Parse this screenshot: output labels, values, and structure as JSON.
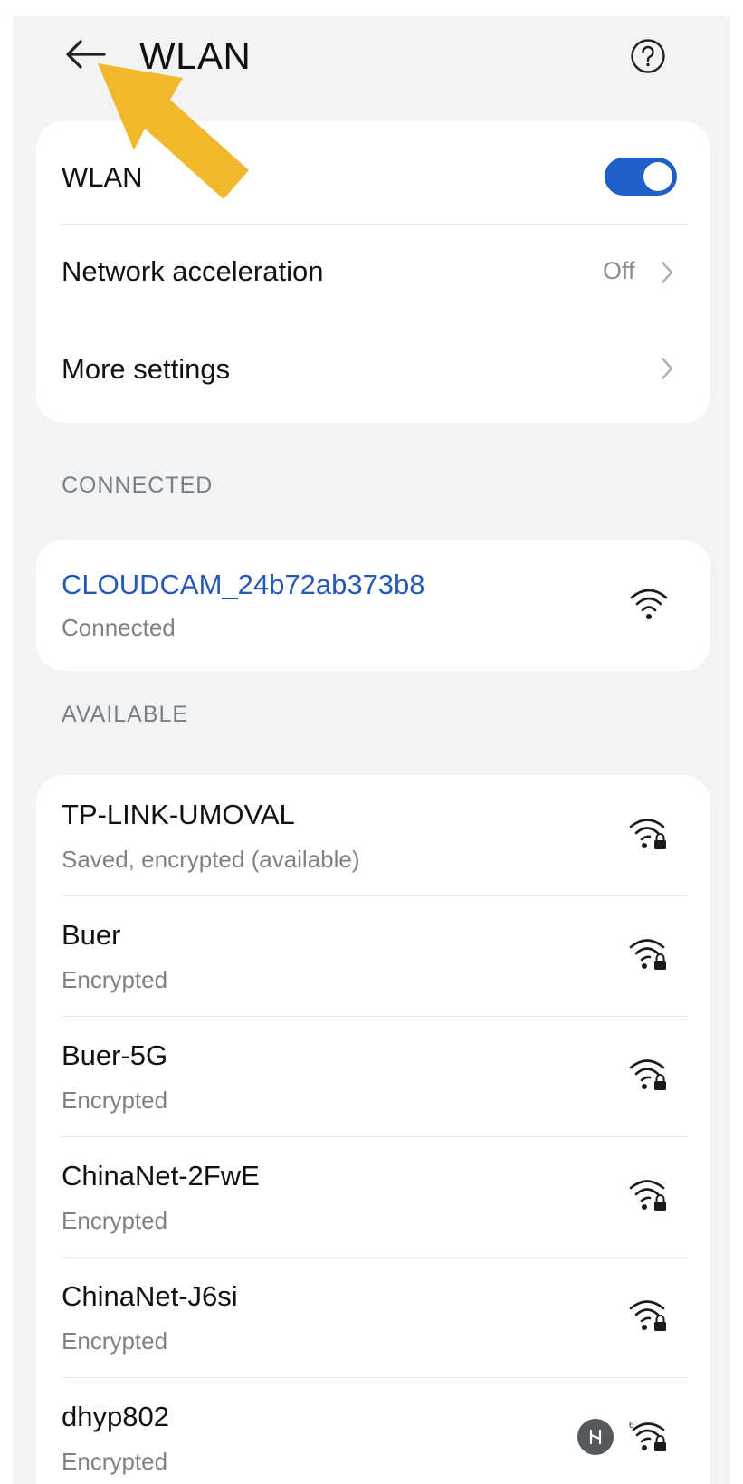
{
  "header": {
    "title": "WLAN",
    "back_icon": "back-arrow-icon",
    "help_icon": "help-icon"
  },
  "settings": {
    "wlan_label": "WLAN",
    "wlan_enabled": true,
    "network_acceleration_label": "Network acceleration",
    "network_acceleration_value": "Off",
    "more_settings_label": "More settings"
  },
  "connected": {
    "section_label": "CONNECTED",
    "network": {
      "name": "CLOUDCAM_24b72ab373b8",
      "status": "Connected"
    }
  },
  "available": {
    "section_label": "AVAILABLE",
    "networks": [
      {
        "name": "TP-LINK-UMOVAL",
        "status": "Saved, encrypted (available)"
      },
      {
        "name": "Buer",
        "status": "Encrypted"
      },
      {
        "name": "Buer-5G",
        "status": "Encrypted"
      },
      {
        "name": "ChinaNet-2FwE",
        "status": "Encrypted"
      },
      {
        "name": "ChinaNet-J6si",
        "status": "Encrypted"
      },
      {
        "name": "dhyp802",
        "status": "Encrypted"
      }
    ]
  },
  "colors": {
    "accent": "#1f5fc7",
    "connected_text": "#2459b8",
    "annotation_arrow": "#f2b82c",
    "background": "#f1f3f5"
  }
}
